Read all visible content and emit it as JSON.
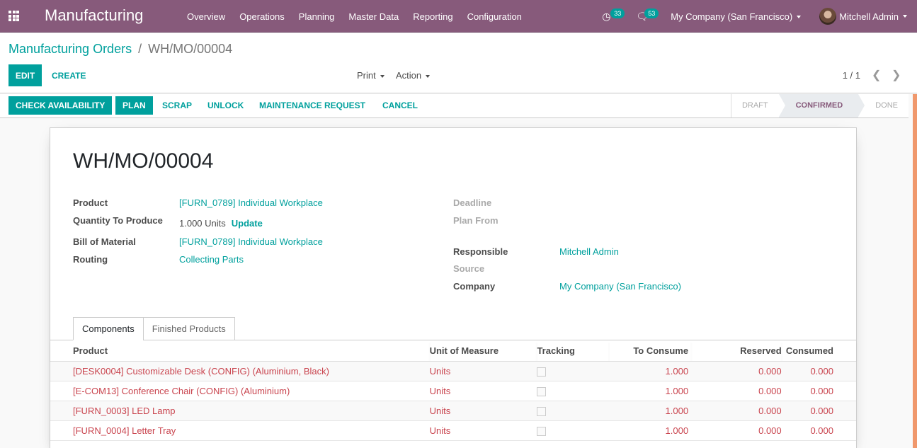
{
  "navbar": {
    "app_name": "Manufacturing",
    "menu": [
      "Overview",
      "Operations",
      "Planning",
      "Master Data",
      "Reporting",
      "Configuration"
    ],
    "activity_count": "33",
    "messages_count": "53",
    "company": "My Company (San Francisco)",
    "user": "Mitchell Admin",
    "colors": {
      "brand": "#875a7b",
      "accent": "#00a09d"
    }
  },
  "breadcrumb": {
    "parent": "Manufacturing Orders",
    "separator": "/",
    "current": "WH/MO/00004"
  },
  "control": {
    "edit": "Edit",
    "create": "Create",
    "print": "Print",
    "action": "Action",
    "pager": "1 / 1"
  },
  "statusbar": {
    "buttons": [
      "Check Availability",
      "Plan",
      "Scrap",
      "Unlock",
      "Maintenance Request",
      "Cancel"
    ],
    "states": [
      "Draft",
      "Confirmed",
      "Done"
    ],
    "current_state": "Confirmed"
  },
  "record": {
    "title": "WH/MO/00004",
    "left_fields": [
      {
        "label": "Product",
        "value": "[FURN_0789] Individual Workplace"
      },
      {
        "label": "Quantity To Produce",
        "value": "1.000 Units",
        "action": "Update"
      },
      {
        "label": "Bill of Material",
        "value": "[FURN_0789] Individual Workplace"
      },
      {
        "label": "Routing",
        "value": "Collecting Parts"
      }
    ],
    "right_fields": [
      {
        "label": "Deadline",
        "value": ""
      },
      {
        "label": "Plan From",
        "value": ""
      },
      {
        "label": "Responsible",
        "value": "Mitchell Admin"
      },
      {
        "label": "Source",
        "value": ""
      },
      {
        "label": "Company",
        "value": "My Company (San Francisco)"
      }
    ]
  },
  "tabs": [
    "Components",
    "Finished Products"
  ],
  "components": {
    "columns": [
      "Product",
      "Unit of Measure",
      "Tracking",
      "To Consume",
      "Reserved",
      "Consumed"
    ],
    "rows": [
      {
        "product": "[DESK0004] Customizable Desk (CONFIG) (Aluminium, Black)",
        "uom": "Units",
        "tracking": false,
        "to_consume": "1.000",
        "reserved": "0.000",
        "consumed": "0.000"
      },
      {
        "product": "[E-COM13] Conference Chair (CONFIG) (Aluminium)",
        "uom": "Units",
        "tracking": false,
        "to_consume": "1.000",
        "reserved": "0.000",
        "consumed": "0.000"
      },
      {
        "product": "[FURN_0003] LED Lamp",
        "uom": "Units",
        "tracking": false,
        "to_consume": "1.000",
        "reserved": "0.000",
        "consumed": "0.000"
      },
      {
        "product": "[FURN_0004] Letter Tray",
        "uom": "Units",
        "tracking": false,
        "to_consume": "1.000",
        "reserved": "0.000",
        "consumed": "0.000"
      }
    ]
  }
}
